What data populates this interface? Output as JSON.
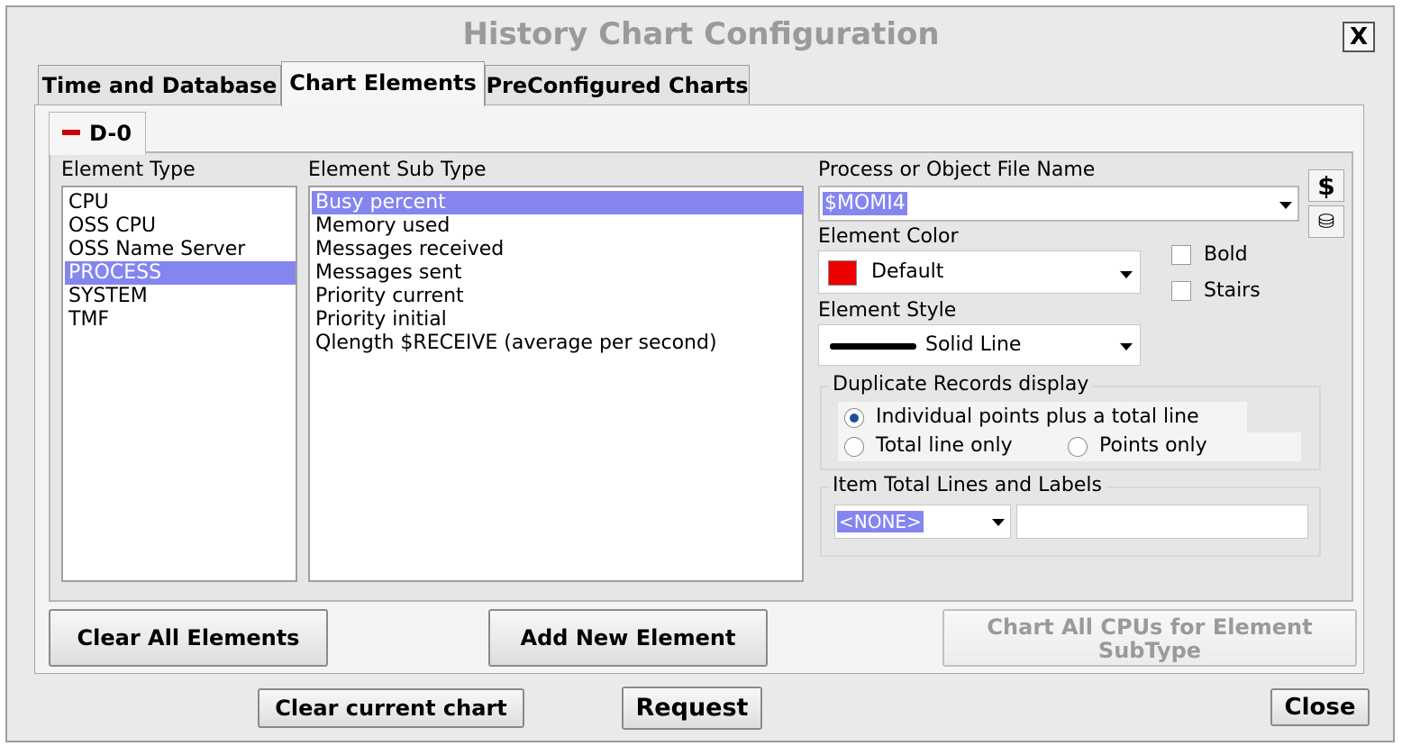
{
  "window": {
    "title": "History Chart Configuration",
    "close_glyph": "X"
  },
  "tabs": [
    {
      "label": "Time and Database",
      "active": false
    },
    {
      "label": "Chart Elements",
      "active": true
    },
    {
      "label": "PreConfigured Charts",
      "active": false
    }
  ],
  "subtab": {
    "label": "D-0"
  },
  "element_type": {
    "label": "Element Type",
    "items": [
      "CPU",
      "OSS CPU",
      "OSS Name Server",
      "PROCESS",
      "SYSTEM",
      "TMF"
    ],
    "selected": "PROCESS"
  },
  "element_sub_type": {
    "label": "Element Sub Type",
    "items": [
      "Busy percent",
      "Memory used",
      "Messages received",
      "Messages sent",
      "Priority current",
      "Priority initial",
      "Qlength $RECEIVE (average per second)"
    ],
    "selected": "Busy percent"
  },
  "process_name": {
    "label": "Process or Object File Name",
    "value": "$MOMI4"
  },
  "side_icons": {
    "dollar": "$",
    "db": "⛁"
  },
  "element_color": {
    "label": "Element Color",
    "value": "Default",
    "swatch": "#ee0000"
  },
  "element_style": {
    "label": "Element Style",
    "value": "Solid Line"
  },
  "checkboxes": {
    "bold": "Bold",
    "stairs": "Stairs"
  },
  "duplicate_records": {
    "label": "Duplicate Records display",
    "options": [
      "Individual points plus a total line",
      "Total line only",
      "Points only"
    ],
    "selected": "Individual points plus a total line"
  },
  "item_total": {
    "label": "Item Total Lines and Labels",
    "value": "<NONE>",
    "text": ""
  },
  "buttons": {
    "clear_all": "Clear All Elements",
    "add_new": "Add New Element",
    "chart_all_line1": "Chart All CPUs for Element",
    "chart_all_line2": "SubType",
    "clear_current": "Clear current chart",
    "request": "Request",
    "close": "Close"
  }
}
